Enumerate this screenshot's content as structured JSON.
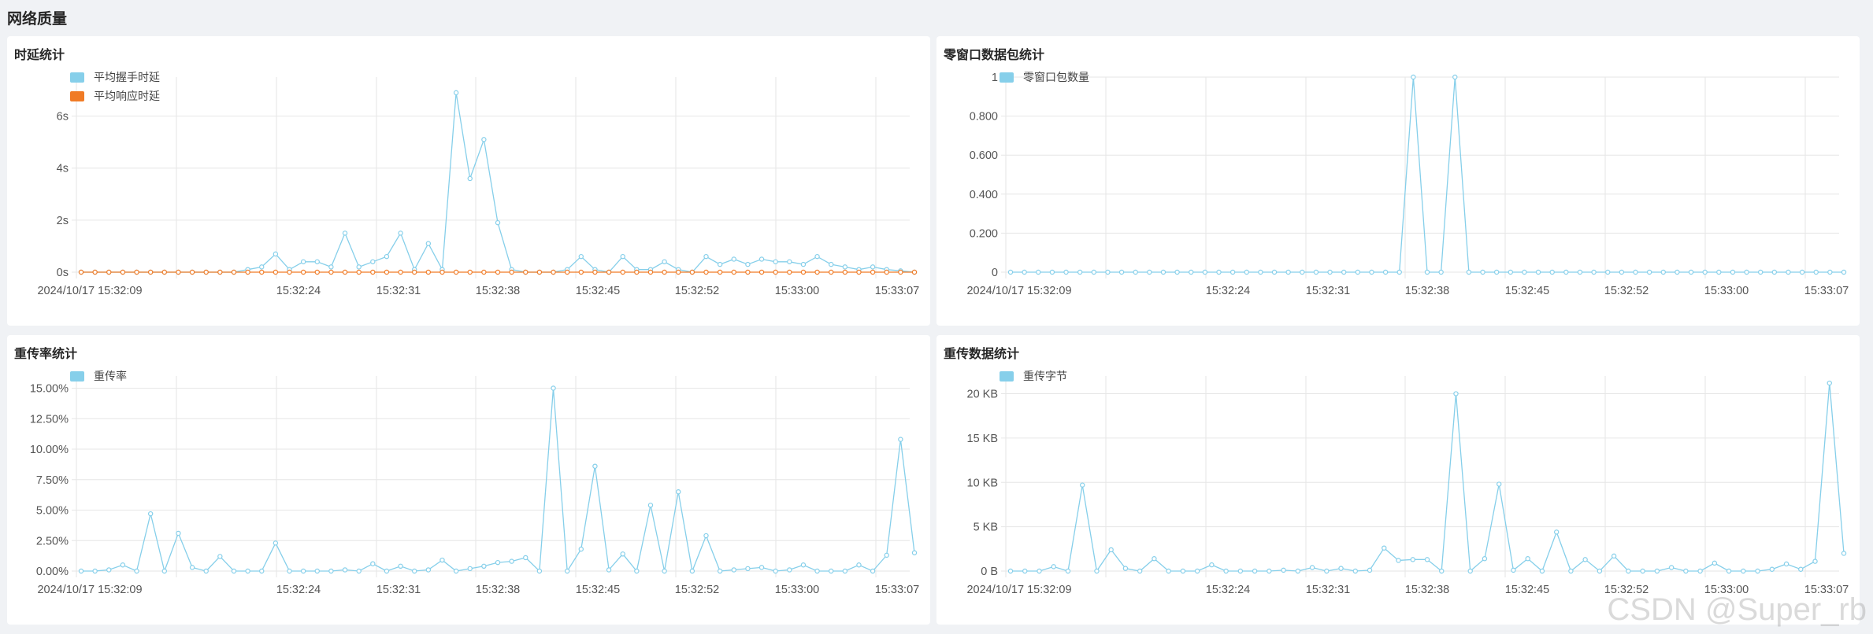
{
  "page": {
    "title": "网络质量"
  },
  "watermark": "CSDN @Super_rb",
  "colors": {
    "blue": "#86cfea",
    "orange": "#f07b26",
    "grid": "#e6e6e6"
  },
  "chart_data": [
    {
      "title": "时延统计",
      "type": "line",
      "legend": [
        "平均握手时延",
        "平均响应时延"
      ],
      "legend_position": "top-left",
      "xlabels": [
        "2024/10/17 15:32:09",
        "15:32:24",
        "15:32:31",
        "15:32:38",
        "15:32:45",
        "15:32:52",
        "15:33:00",
        "15:33:07"
      ],
      "ylim": [
        0,
        7.5
      ],
      "ytick_values": [
        0,
        2,
        4,
        6
      ],
      "ytick_labels": [
        "0s",
        "2s",
        "4s",
        "6s"
      ],
      "series": [
        {
          "name": "平均握手时延",
          "color": "#86cfea",
          "values": [
            0,
            0,
            0,
            0,
            0,
            0,
            0,
            0,
            0,
            0,
            0,
            0,
            0.1,
            0.2,
            0.7,
            0.1,
            0.4,
            0.4,
            0.2,
            1.5,
            0.2,
            0.4,
            0.6,
            1.5,
            0.1,
            1.1,
            0.1,
            6.9,
            3.6,
            5.1,
            1.9,
            0.1,
            0,
            0,
            0,
            0.1,
            0.6,
            0.1,
            0,
            0.6,
            0.1,
            0.1,
            0.4,
            0.1,
            0,
            0.6,
            0.3,
            0.5,
            0.3,
            0.5,
            0.4,
            0.4,
            0.3,
            0.6,
            0.3,
            0.2,
            0.1,
            0.2,
            0.1,
            0.05,
            0
          ]
        },
        {
          "name": "平均响应时延",
          "color": "#f07b26",
          "values": [
            0,
            0,
            0,
            0,
            0,
            0,
            0,
            0,
            0,
            0,
            0,
            0,
            0,
            0,
            0,
            0,
            0,
            0,
            0,
            0,
            0,
            0,
            0,
            0,
            0,
            0,
            0,
            0,
            0,
            0,
            0,
            0,
            0,
            0,
            0,
            0,
            0,
            0,
            0,
            0,
            0,
            0,
            0,
            0,
            0,
            0,
            0,
            0,
            0,
            0,
            0,
            0,
            0,
            0,
            0,
            0,
            0,
            0,
            0,
            0,
            0
          ]
        }
      ]
    },
    {
      "title": "零窗口数据包统计",
      "type": "line",
      "legend": [
        "零窗口包数量"
      ],
      "legend_position": "top-left",
      "xlabels": [
        "2024/10/17 15:32:09",
        "15:32:24",
        "15:32:31",
        "15:32:38",
        "15:32:45",
        "15:32:52",
        "15:33:00",
        "15:33:07"
      ],
      "ylim": [
        0,
        1
      ],
      "ytick_values": [
        0,
        0.2,
        0.4,
        0.6,
        0.8,
        1
      ],
      "ytick_labels": [
        "0",
        "0.200",
        "0.400",
        "0.600",
        "0.800",
        "1"
      ],
      "series": [
        {
          "name": "零窗口包数量",
          "color": "#86cfea",
          "values": [
            0,
            0,
            0,
            0,
            0,
            0,
            0,
            0,
            0,
            0,
            0,
            0,
            0,
            0,
            0,
            0,
            0,
            0,
            0,
            0,
            0,
            0,
            0,
            0,
            0,
            0,
            0,
            0,
            0,
            1,
            0,
            0,
            1,
            0,
            0,
            0,
            0,
            0,
            0,
            0,
            0,
            0,
            0,
            0,
            0,
            0,
            0,
            0,
            0,
            0,
            0,
            0,
            0,
            0,
            0,
            0,
            0,
            0,
            0,
            0,
            0
          ]
        }
      ]
    },
    {
      "title": "重传率统计",
      "type": "line",
      "legend": [
        "重传率"
      ],
      "legend_position": "top-left",
      "xlabels": [
        "2024/10/17 15:32:09",
        "15:32:24",
        "15:32:31",
        "15:32:38",
        "15:32:45",
        "15:32:52",
        "15:33:00",
        "15:33:07"
      ],
      "ylim": [
        0,
        16
      ],
      "ytick_values": [
        0,
        2.5,
        5,
        7.5,
        10,
        12.5,
        15
      ],
      "ytick_labels": [
        "0.00%",
        "2.50%",
        "5.00%",
        "7.50%",
        "10.00%",
        "12.50%",
        "15.00%"
      ],
      "series": [
        {
          "name": "重传率",
          "color": "#86cfea",
          "values": [
            0,
            0,
            0.1,
            0.5,
            0,
            4.7,
            0,
            3.1,
            0.3,
            0,
            1.2,
            0,
            0,
            0,
            2.3,
            0,
            0,
            0,
            0,
            0.1,
            0,
            0.6,
            0,
            0.4,
            0,
            0.1,
            0.9,
            0,
            0.2,
            0.4,
            0.7,
            0.8,
            1.1,
            0,
            15,
            0,
            1.8,
            8.6,
            0.1,
            1.4,
            0,
            5.4,
            0,
            6.5,
            0,
            2.9,
            0,
            0.1,
            0.2,
            0.3,
            0,
            0.1,
            0.5,
            0,
            0,
            0,
            0.5,
            0,
            1.3,
            10.8,
            1.5
          ]
        }
      ]
    },
    {
      "title": "重传数据统计",
      "type": "line",
      "legend": [
        "重传字节"
      ],
      "legend_position": "top-left",
      "xlabels": [
        "2024/10/17 15:32:09",
        "15:32:24",
        "15:32:31",
        "15:32:38",
        "15:32:45",
        "15:32:52",
        "15:33:00",
        "15:33:07"
      ],
      "ylim": [
        0,
        22
      ],
      "ytick_values": [
        0,
        5,
        10,
        15,
        20
      ],
      "ytick_labels": [
        "0 B",
        "5 KB",
        "10 KB",
        "15 KB",
        "20 KB"
      ],
      "series": [
        {
          "name": "重传字节",
          "color": "#86cfea",
          "values": [
            0,
            0,
            0,
            0.5,
            0,
            9.7,
            0,
            2.4,
            0.3,
            0,
            1.4,
            0,
            0,
            0,
            0.7,
            0,
            0,
            0,
            0,
            0.1,
            0,
            0.4,
            0,
            0.3,
            0,
            0.1,
            2.6,
            1.2,
            1.3,
            1.3,
            0,
            20,
            0,
            1.4,
            9.8,
            0.1,
            1.4,
            0,
            4.4,
            0,
            1.3,
            0,
            1.7,
            0,
            0,
            0,
            0.4,
            0,
            0,
            0.9,
            0,
            0,
            0,
            0.2,
            0.8,
            0.2,
            1.1,
            21.2,
            2
          ]
        }
      ]
    }
  ]
}
